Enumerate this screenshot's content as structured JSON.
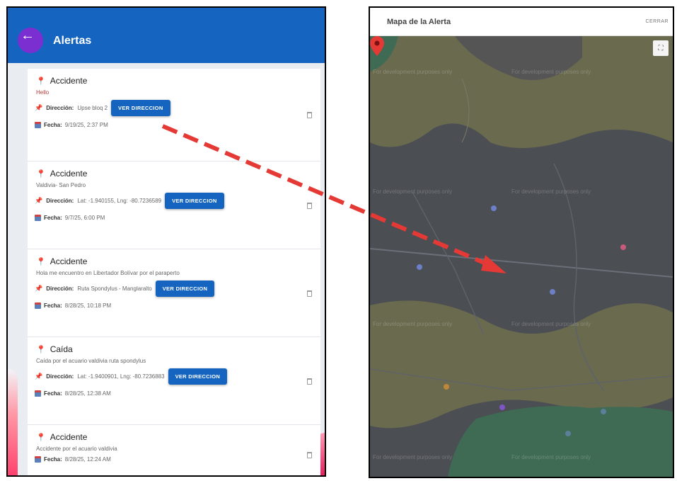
{
  "alerts_panel": {
    "title": "Alertas",
    "back_icon": "arrow-left-icon",
    "accent_color": "#1565c0",
    "direction_label": "Dirección:",
    "date_label": "Fecha:",
    "button_label": "VER DIRECCION",
    "items": [
      {
        "type": "Accidente",
        "description": "Hello",
        "address": "Upse bloq 2",
        "date": "9/19/25, 2:37 PM"
      },
      {
        "type": "Accidente",
        "description": "Valdivia- San Pedro",
        "address": "Lat: -1.940155, Lng: -80.7236589",
        "date": "9/7/25, 6:00 PM"
      },
      {
        "type": "Accidente",
        "description": "Hola me encuentro en Libertador Bolívar por el paraperto",
        "address": "Ruta Spondylus - Manglaralto",
        "date": "8/28/25, 10:18 PM"
      },
      {
        "type": "Caída",
        "description": "Caída por el acuario valdivia ruta spondylus",
        "address": "Lat: -1.9400901, Lng: -80.7236883",
        "date": "8/28/25, 12:38 AM"
      },
      {
        "type": "Accidente",
        "description": "Accidente por el acuario valdivia",
        "date": "8/28/25, 12:24 AM"
      }
    ]
  },
  "map_panel": {
    "title": "Mapa de la Alerta",
    "close_label": "CERRAR",
    "fullscreen_icon": "fullscreen-icon",
    "marker_icon": "map-pin-icon",
    "marker_color": "#e53935",
    "watermark": "For development purposes only"
  },
  "annotation": {
    "arrow_color": "#e53935",
    "arrow_style": "dashed"
  }
}
